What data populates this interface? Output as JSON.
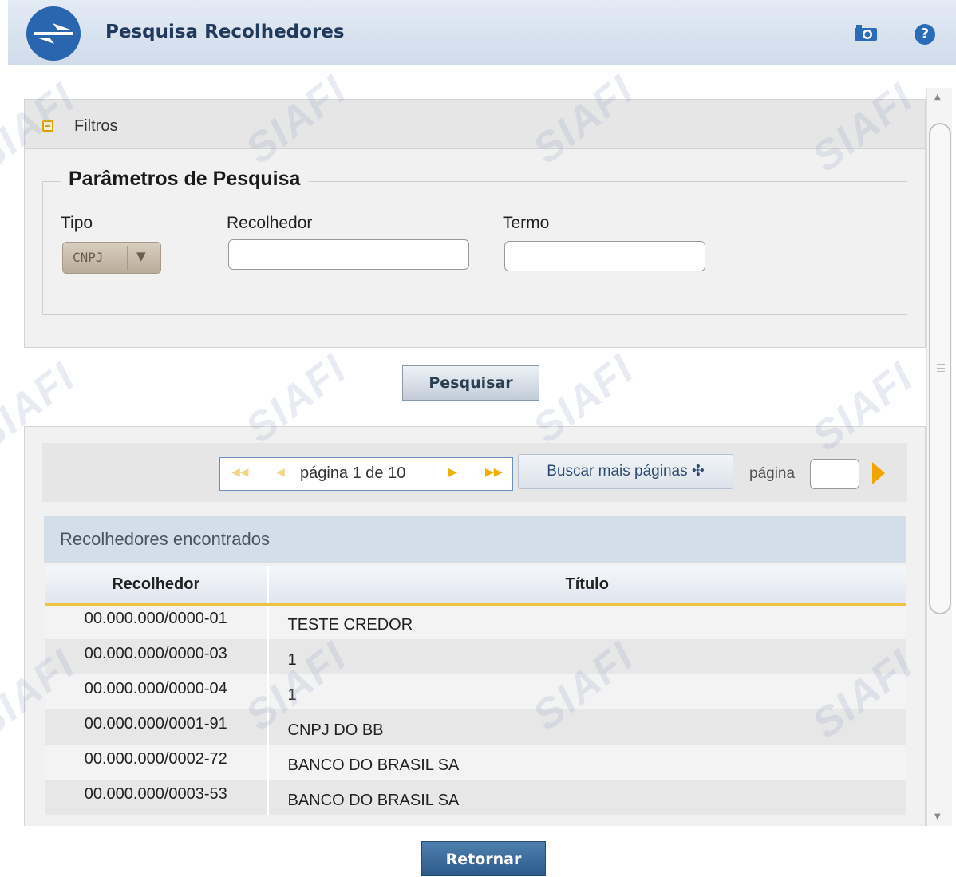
{
  "header": {
    "title": "Pesquisa Recolhedores",
    "camera_icon": "camera-icon",
    "help_icon": "help-icon",
    "help_glyph": "?",
    "accent": "#2b6cb8"
  },
  "watermark": "SIAFI",
  "filtros": {
    "label": "Filtros",
    "legend": "Parâmetros de Pesquisa",
    "tipo_label": "Tipo",
    "tipo_value": "CNPJ",
    "tipo_arrow": "▼",
    "recolhedor_label": "Recolhedor",
    "recolhedor_value": "",
    "termo_label": "Termo",
    "termo_value": ""
  },
  "pesquisar_label": "Pesquisar",
  "pager": {
    "first": "◀◀",
    "prev": "◀",
    "text": "página 1 de 10",
    "next": "▶",
    "last": "▶▶",
    "buscar_label": "Buscar mais páginas ✣",
    "pagina_label": "página",
    "pagina_value": ""
  },
  "results": {
    "caption": "Recolhedores encontrados",
    "columns": [
      "Recolhedor",
      "Título"
    ],
    "rows": [
      [
        "00.000.000/0000-01",
        "TESTE CREDOR"
      ],
      [
        "00.000.000/0000-03",
        "1"
      ],
      [
        "00.000.000/0000-04",
        "1"
      ],
      [
        "00.000.000/0001-91",
        "CNPJ DO BB"
      ],
      [
        "00.000.000/0002-72",
        "BANCO DO BRASIL SA"
      ],
      [
        "00.000.000/0003-53",
        "BANCO DO BRASIL SA"
      ]
    ]
  },
  "retornar_label": "Retornar",
  "scrollbar": {
    "up": "▲",
    "down": "▼"
  }
}
